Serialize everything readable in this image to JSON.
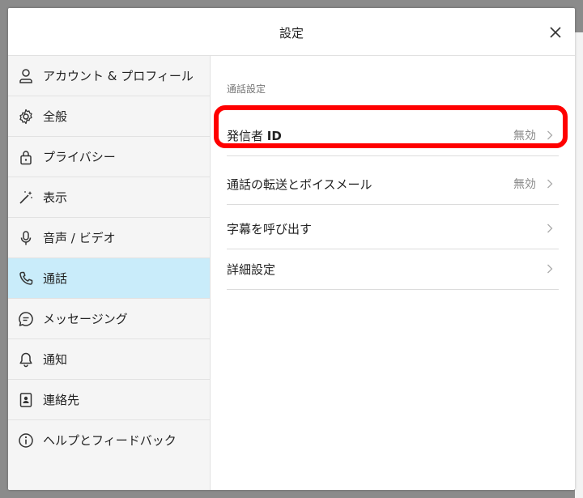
{
  "dialog": {
    "title": "設定",
    "close_label": "×"
  },
  "sidebar": {
    "items": [
      {
        "label": "アカウント & プロフィール",
        "icon": "person-icon"
      },
      {
        "label": "全般",
        "icon": "gear-icon"
      },
      {
        "label": "プライバシー",
        "icon": "lock-icon"
      },
      {
        "label": "表示",
        "icon": "magic-wand-icon"
      },
      {
        "label": "音声 / ビデオ",
        "icon": "microphone-icon"
      },
      {
        "label": "通話",
        "icon": "phone-icon",
        "active": true
      },
      {
        "label": "メッセージング",
        "icon": "chat-bubble-icon"
      },
      {
        "label": "通知",
        "icon": "bell-icon"
      },
      {
        "label": "連絡先",
        "icon": "contact-card-icon"
      },
      {
        "label": "ヘルプとフィードバック",
        "icon": "info-icon"
      }
    ]
  },
  "content": {
    "section_title": "通話設定",
    "rows": [
      {
        "label_prefix": "発信者 ",
        "label_bold": "ID",
        "value": "無効"
      },
      {
        "label": "通話の転送とボイスメール",
        "value": "無効"
      },
      {
        "label": "字幕を呼び出す",
        "value": ""
      },
      {
        "label": "詳細設定",
        "value": ""
      }
    ]
  },
  "colors": {
    "active_bg": "#c9ecfa",
    "highlight": "#ff0000",
    "backdrop": "#8b8b8b"
  }
}
